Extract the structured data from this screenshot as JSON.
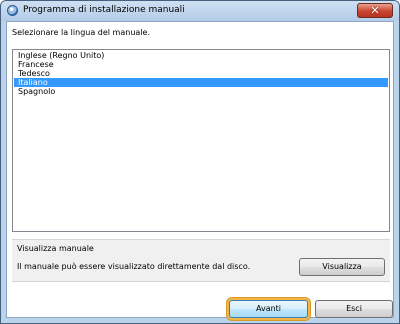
{
  "window": {
    "title": "Programma di installazione manuali",
    "close_label": "✕"
  },
  "instruction": "Selezionare la lingua del manuale.",
  "languages": [
    "Inglese (Regno Unito)",
    "Francese",
    "Tedesco",
    "Italiano",
    "Spagnolo"
  ],
  "selected_language": "Italiano",
  "view_group": {
    "title": "Visualizza manuale",
    "description": "Il manuale può essere visualizzato direttamente dal disco.",
    "button_label": "Visualizza"
  },
  "footer": {
    "next_label": "Avanti",
    "exit_label": "Esci"
  },
  "colors": {
    "selection": "#3399ff",
    "focus_ring": "#f2b648",
    "close_button": "#c8452f"
  }
}
